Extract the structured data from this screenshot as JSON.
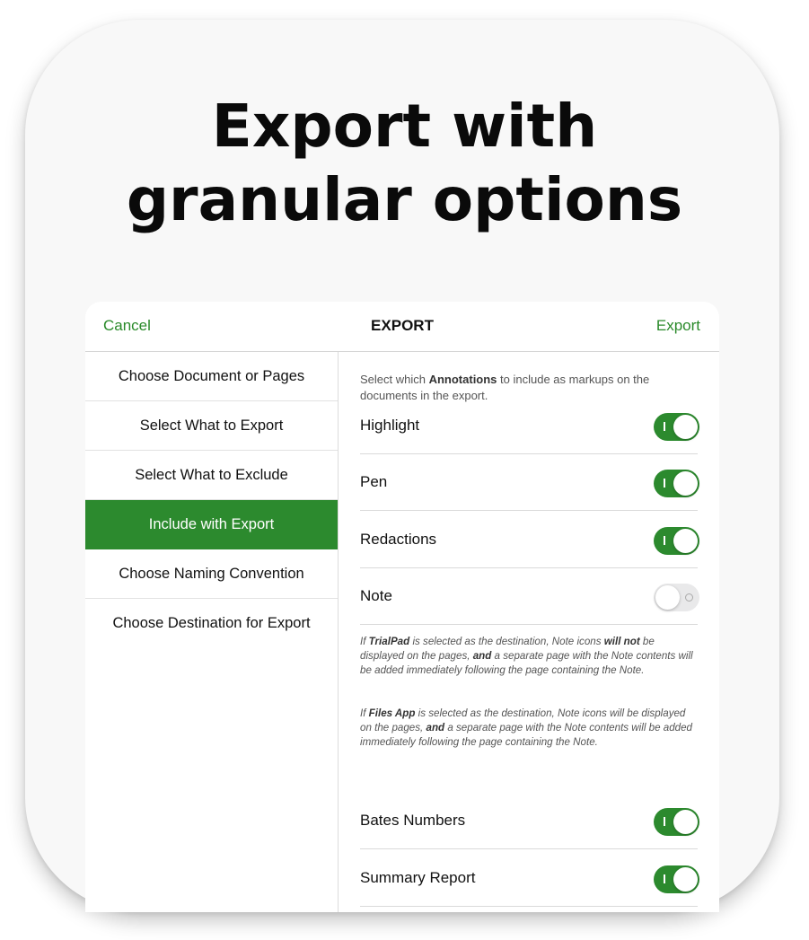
{
  "headline": {
    "line1": "Export with",
    "line2": "granular options"
  },
  "navbar": {
    "cancel": "Cancel",
    "title": "EXPORT",
    "export": "Export"
  },
  "sidebar": {
    "items": [
      {
        "label": "Choose Document or Pages",
        "active": false
      },
      {
        "label": "Select What to Export",
        "active": false
      },
      {
        "label": "Select What to Exclude",
        "active": false
      },
      {
        "label": "Include with Export",
        "active": true
      },
      {
        "label": "Choose Naming Convention",
        "active": false
      },
      {
        "label": "Choose Destination for Export",
        "active": false
      }
    ]
  },
  "content": {
    "intro": {
      "before": "Select which ",
      "bold": "Annotations",
      "after": " to include as markups on the documents in the export."
    },
    "toggles": [
      {
        "label": "Highlight",
        "on": true
      },
      {
        "label": "Pen",
        "on": true
      },
      {
        "label": "Redactions",
        "on": true
      },
      {
        "label": "Note",
        "on": false
      },
      {
        "label": "Bates Numbers",
        "on": true
      },
      {
        "label": "Summary Report",
        "on": true
      }
    ],
    "note_info_1": {
      "p1": "If ",
      "b1": "TrialPad",
      "p2": " is selected as the destination, Note icons ",
      "b2": "will not",
      "p3": " be displayed on the pages, ",
      "b3": "and",
      "p4": " a separate page with the Note contents will be added immediately following the page containing the Note."
    },
    "note_info_2": {
      "p1": "If ",
      "b1": "Files App",
      "p2": " is selected as the destination, Note icons will be displayed on the pages, ",
      "b2": "and",
      "p3": " a separate page with the Note contents will be added immediately following the page containing the Note."
    }
  },
  "colors": {
    "accent": "#2c8a2e",
    "toggle_off": "#e9e9ea"
  }
}
